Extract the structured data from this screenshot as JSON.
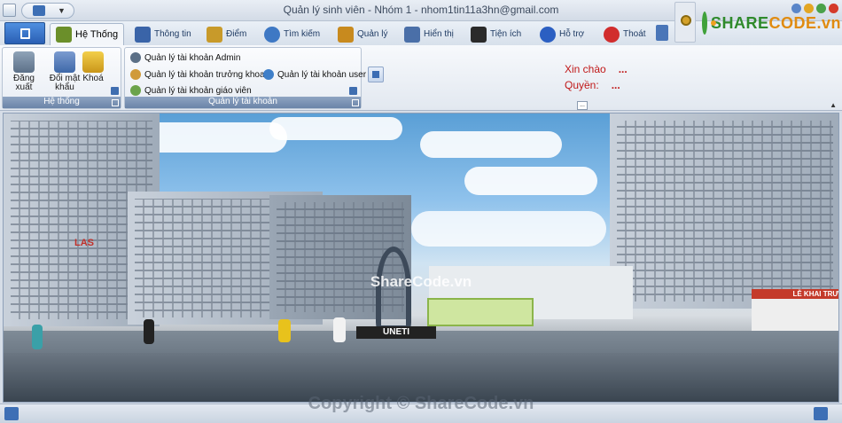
{
  "window": {
    "title": "Quản lý sinh viên - Nhóm 1 - nhom1tin11a3hn@gmail.com"
  },
  "tabs": [
    {
      "label": "Hệ Thống",
      "icon": "users-gear-icon",
      "color": "#6b8f2a"
    },
    {
      "label": "Thông tin",
      "icon": "person-info-icon",
      "color": "#3a64a8"
    },
    {
      "label": "Điểm",
      "icon": "grade-sheet-icon",
      "color": "#c89a2a"
    },
    {
      "label": "Tìm kiếm",
      "icon": "search-icon",
      "color": "#3e78c4"
    },
    {
      "label": "Quản lý",
      "icon": "clipboard-icon",
      "color": "#c88a1e"
    },
    {
      "label": "Hiển thị",
      "icon": "display-icon",
      "color": "#4a6fa8"
    },
    {
      "label": "Tiện ích",
      "icon": "grid-icon",
      "color": "#2a2a2a"
    },
    {
      "label": "Hỗ trợ",
      "icon": "help-icon",
      "color": "#2b5fc2"
    },
    {
      "label": "Thoát",
      "icon": "exit-icon",
      "color": "#d12d2d"
    }
  ],
  "logo": {
    "part1": "SHARE",
    "part2": "CODE.vn"
  },
  "ribbon": {
    "he_thong_group": {
      "label": "Hệ thống",
      "buttons": [
        {
          "label": "Đăng xuất",
          "icon": "logout-user-icon"
        },
        {
          "label": "Đổi mật khẩu",
          "icon": "change-password-icon"
        },
        {
          "label": "Khoá",
          "icon": "lock-icon"
        }
      ]
    },
    "quan_ly_tai_khoan_group": {
      "label": "Quản lý tài khoản",
      "buttons": [
        {
          "label": "Quản lý tài khoản Admin",
          "icon": "admin-user-icon"
        },
        {
          "label": "Quản lý tài khoản trưởng khoa",
          "icon": "dean-user-icon"
        },
        {
          "label": "Quản lý tài khoản giáo viên",
          "icon": "teacher-user-icon"
        },
        {
          "label": "Quản lý tài khoản user",
          "icon": "users-icon"
        }
      ]
    },
    "info": {
      "greeting_label": "Xin chào",
      "greeting_value": "...",
      "role_label": "Quyền:",
      "role_value": "..."
    },
    "more_label": "...",
    "collapse_label": "▲"
  },
  "content": {
    "sign_text": "UNETI",
    "las_text": "LAS",
    "watermark": "ShareCode.vn",
    "banner_text": "LỄ KHAI TRƯ"
  },
  "status": {
    "copyright": "Copyright © ShareCode.vn"
  },
  "colors": {
    "accent": "#2a5fb4",
    "info_text": "#c01818",
    "ribbon_label_bg": "#7d93b5"
  }
}
